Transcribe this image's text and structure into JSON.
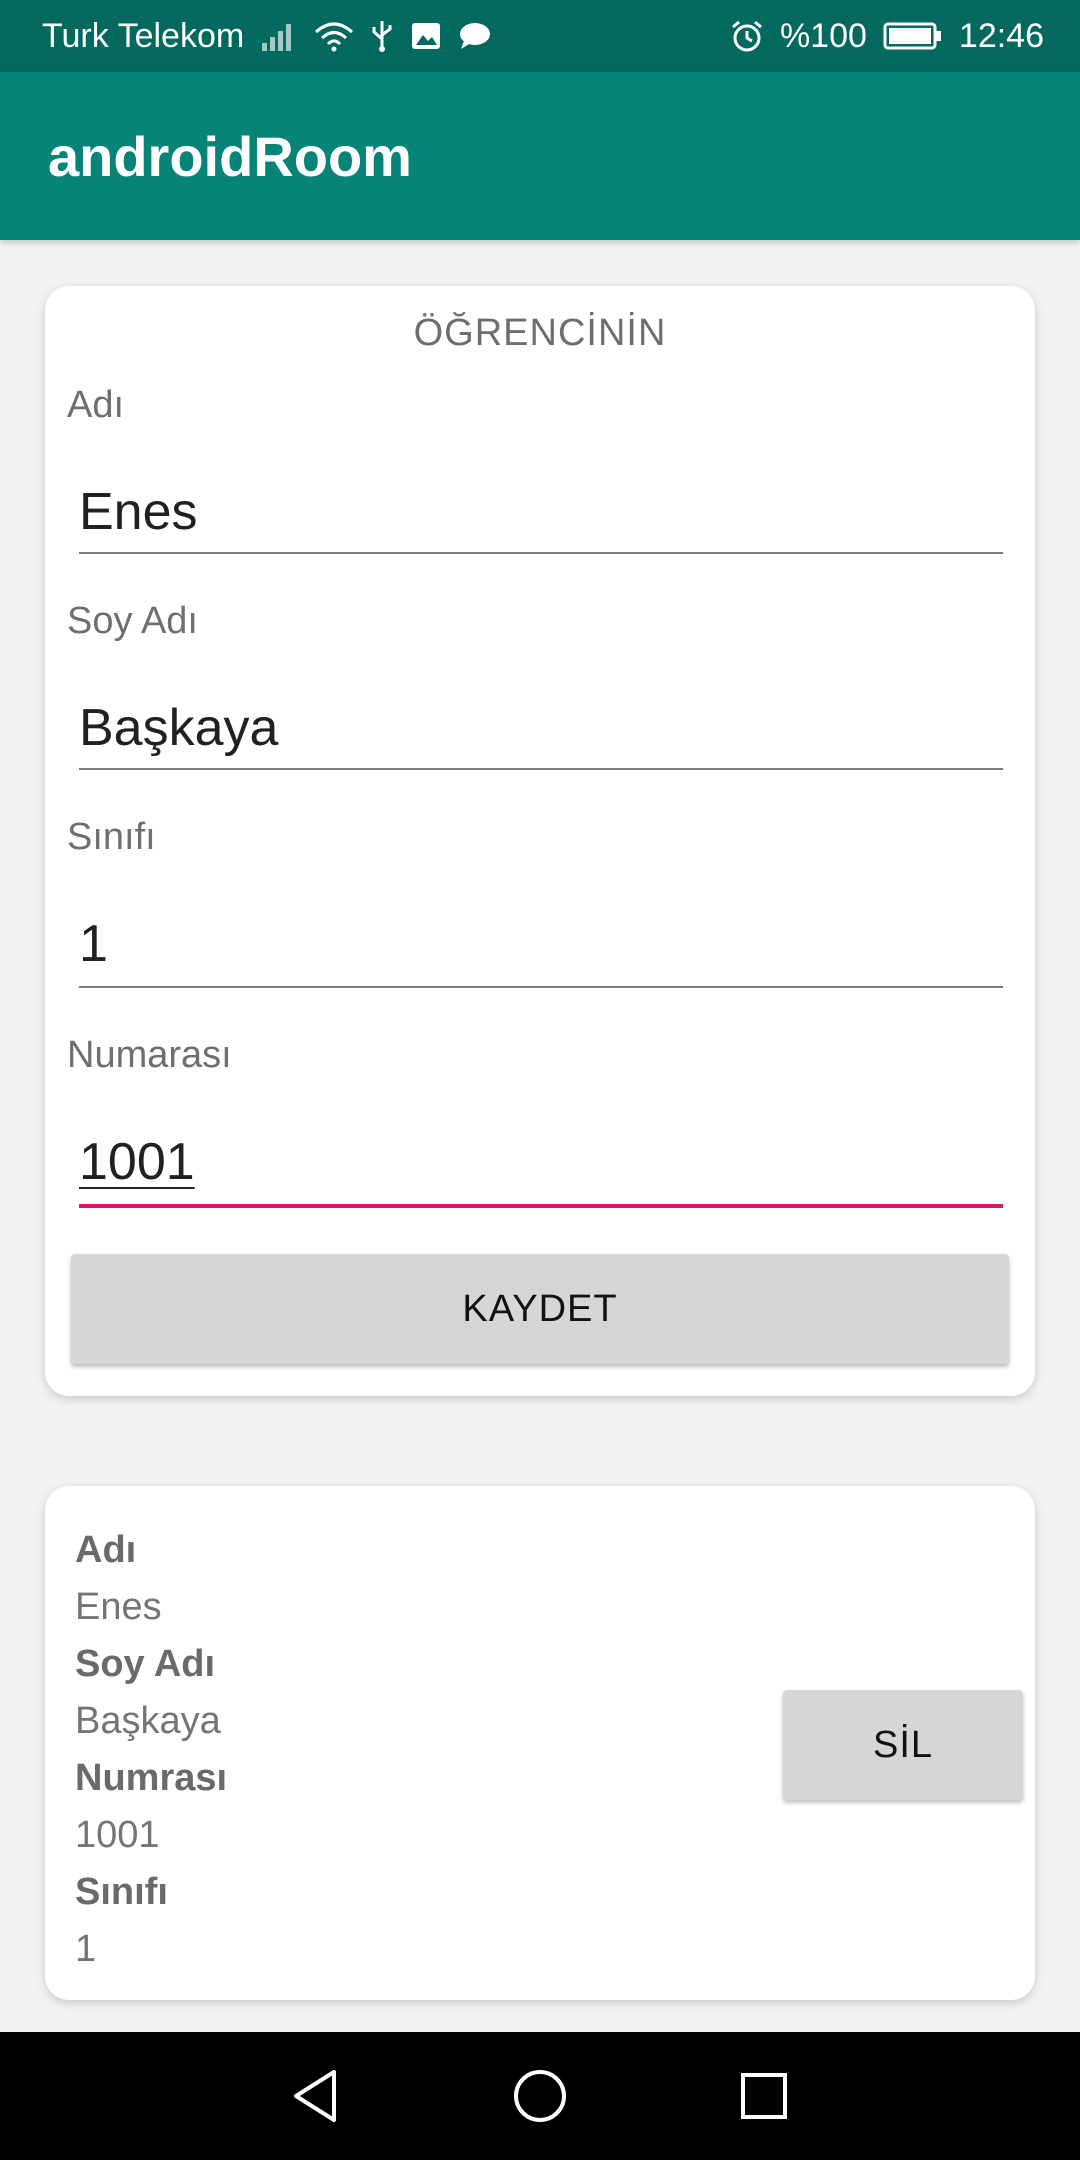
{
  "status_bar": {
    "carrier": "Turk Telekom",
    "battery_text": "%100",
    "time": "12:46",
    "icons": [
      "signal-icon",
      "wifi-icon",
      "usb-icon",
      "gallery-icon",
      "message-icon",
      "alarm-icon",
      "battery-icon"
    ]
  },
  "app_bar": {
    "title": "androidRoom"
  },
  "form": {
    "heading": "ÖĞRENCİNİN",
    "fields": [
      {
        "label": "Adı",
        "value": "Enes"
      },
      {
        "label": "Soy Adı",
        "value": "Başkaya"
      },
      {
        "label": "Sınıfı",
        "value": "1"
      },
      {
        "label": "Numarası",
        "value": "1001"
      }
    ],
    "save_label": "KAYDET",
    "accent_color": "#d81b60"
  },
  "record": {
    "name_label": "Adı",
    "name_value": "Enes",
    "surname_label": "Soy Adı",
    "surname_value": "Başkaya",
    "number_label": "Numrası",
    "number_value": "1001",
    "class_label": "Sınıfı",
    "class_value": "1",
    "delete_label": "SİL"
  },
  "nav_bar": {
    "icons": [
      "back-icon",
      "home-icon",
      "recents-icon"
    ]
  },
  "colors": {
    "status_bar": "#03695f",
    "app_bar": "#078477",
    "background": "#f3f3f3"
  }
}
